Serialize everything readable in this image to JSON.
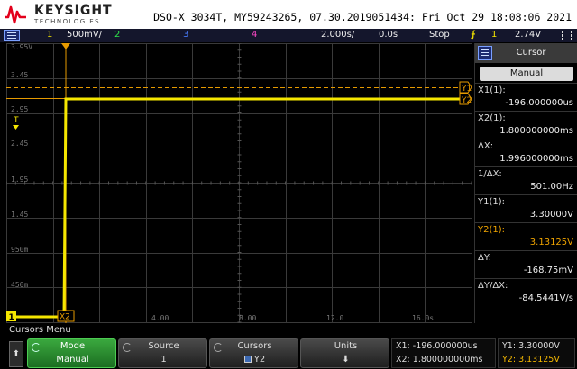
{
  "header": {
    "brand": "KEYSIGHT",
    "brand_sub": "TECHNOLOGIES",
    "scope_info": "DSO-X 3034T, MY59243265, 07.30.2019051434: Fri Oct 29 18:08:06 2021"
  },
  "status": {
    "ch1_num": "1",
    "ch1_scale": "500mV/",
    "ch2_num": "2",
    "ch3_num": "3",
    "ch4_num": "4",
    "timebase": "2.000s/",
    "delay": "0.0s",
    "run_state": "Stop",
    "trig_icon": "trigger-edge-icon",
    "trig_glyph": "⨍",
    "trig_channel": "1",
    "trig_level": "2.74V"
  },
  "graticule": {
    "y_labels": [
      "3.95V",
      "3.45",
      "2.95",
      "2.45",
      "1.95",
      "1.45",
      "950m",
      "450m"
    ],
    "x_labels": [
      "4.00",
      "8.00",
      "12.0",
      "16.0s"
    ],
    "trace_color": "#f5e600",
    "cursor_color": "#e69a00",
    "marker_y1": "Y1",
    "marker_y2": "Y2",
    "marker_x2": "X2",
    "marker_ch1": "1",
    "marker_t": "T"
  },
  "panel": {
    "title": "Cursor",
    "mode_button": "Manual",
    "entries": [
      {
        "label": "X1(1):",
        "value": "-196.000000us"
      },
      {
        "label": "X2(1):",
        "value": "1.800000000ms"
      },
      {
        "label": "ΔX:",
        "value": "1.996000000ms"
      },
      {
        "label": "1/ΔX:",
        "value": "501.00Hz"
      },
      {
        "label": "Y1(1):",
        "value": "3.30000V"
      },
      {
        "label": "Y2(1):",
        "value": "3.13125V"
      },
      {
        "label": "ΔY:",
        "value": "-168.75mV"
      },
      {
        "label": "ΔY/ΔX:",
        "value": "-84.5441V/s"
      }
    ]
  },
  "menu": {
    "title": "Cursors Menu",
    "arrow": "⬆",
    "softkeys": [
      {
        "top": "Mode",
        "bottom": "Manual"
      },
      {
        "top": "Source",
        "bottom": "1"
      },
      {
        "top": "Cursors",
        "bottom": "Y2"
      },
      {
        "top": "Units",
        "bottom": "⬇"
      }
    ],
    "readout_x1": "X1: -196.000000us",
    "readout_x2": "X2: 1.800000000ms",
    "readout_y1": "Y1: 3.30000V",
    "readout_y2": "Y2: 3.13125V"
  }
}
